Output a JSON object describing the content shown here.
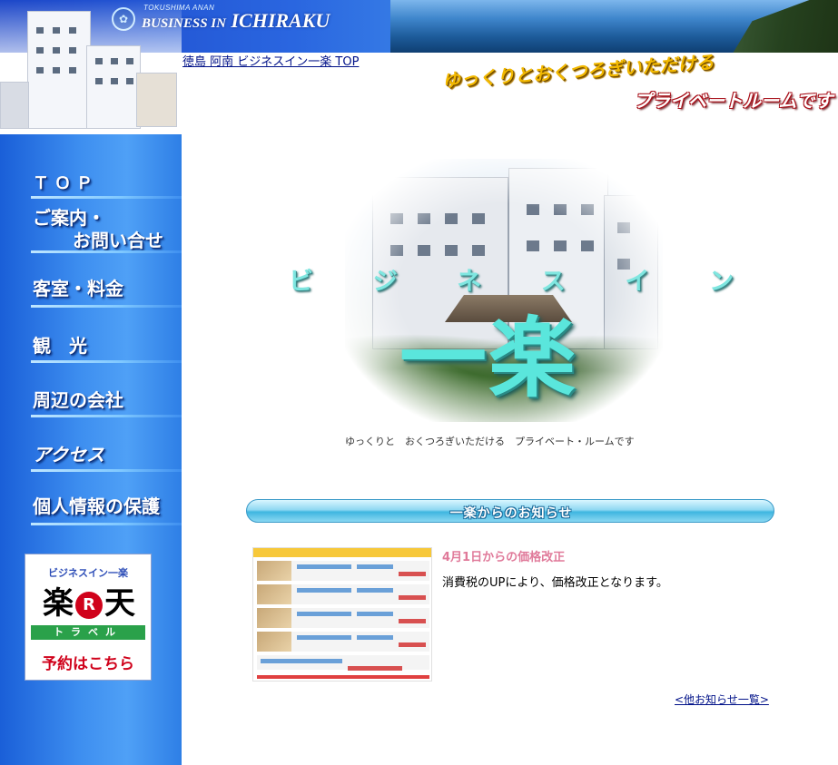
{
  "header": {
    "brand_small": "TOKUSHIMA ANAN",
    "brand_prefix": "BUSINESS IN",
    "brand_name": "ICHIRAKU"
  },
  "breadcrumb": {
    "top_link": "徳島 阿南 ビジネスイン一楽 TOP"
  },
  "tagline": {
    "line1": "ゆっくりとおくつろぎいただける",
    "line2": "プライベートルームです"
  },
  "sidebar": {
    "items": [
      {
        "label": "ＴＯＰ"
      },
      {
        "label_line1": "ご案内・",
        "label_line2": "お問い合せ"
      },
      {
        "label": "客室・料金"
      },
      {
        "label": "観　光"
      },
      {
        "label": "周辺の会社"
      },
      {
        "label": "アクセス"
      },
      {
        "label": "個人情報の保護"
      }
    ]
  },
  "rakuten": {
    "top_text": "ビジネスイン一楽",
    "logo_left": "楽",
    "logo_mark": "R",
    "logo_right": "天",
    "travel": "トラベル",
    "cta": "予約はこちら"
  },
  "hero": {
    "kana": [
      "ビ",
      "ジ",
      "ネ",
      "ス",
      "イ",
      "ン"
    ],
    "kanji": "一楽",
    "caption": "ゆっくりと　おくつろぎいただける　プライベート・ルームです"
  },
  "news": {
    "bar_title": "一楽からのお知らせ",
    "item_title": "4月1日からの価格改正",
    "item_body": "消費税のUPにより、価格改正となります。",
    "more_link": "<他お知らせ一覧>"
  },
  "colors": {
    "sidebar_blue": "#3e8ff0",
    "link_blue": "#001188",
    "news_title_pink": "#e07a9a",
    "hero_cyan": "#5ae6dc",
    "tagline_gold": "#f2b800",
    "tagline_red": "#a8101a"
  }
}
